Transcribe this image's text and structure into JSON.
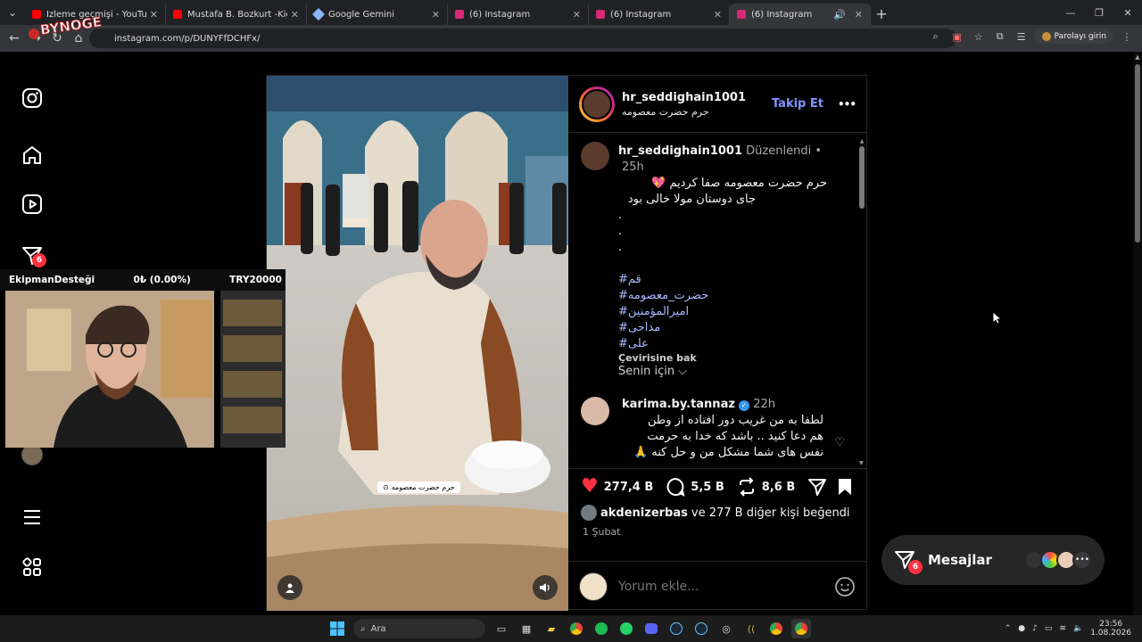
{
  "browser": {
    "tabs": [
      {
        "title": "İzleme geçmişi - YouTube",
        "favicon_color": "#ff0000",
        "active": false
      },
      {
        "title": "Mustafa B. Bozkurt -Kick Kesitle",
        "favicon_color": "#ff0000",
        "active": false
      },
      {
        "title": "Google Gemini",
        "favicon_color": "#8ab4f8",
        "active": false
      },
      {
        "title": "(6) Instagram",
        "favicon_color": "#d62976",
        "active": false
      },
      {
        "title": "(6) Instagram",
        "favicon_color": "#d62976",
        "active": false
      },
      {
        "title": "(6) Instagram",
        "favicon_color": "#d62976",
        "active": true
      }
    ],
    "url": "instagram.com/p/DUNYFfDCHFx/",
    "password_button": "Parolayı girin",
    "overlay_logo_text": "BYNOGE"
  },
  "nav": {
    "notifications_badge": "6"
  },
  "post": {
    "author": "hr_seddighain1001",
    "location": "حرم حضرت معصومه",
    "follow_label": "Takip Et",
    "more_label": "•••",
    "caption": {
      "author": "hr_seddighain1001",
      "edited": "Düzenlendi",
      "dot": "•",
      "time": "25h",
      "line1": "حرم حضرت معصومه صفا کردیم 💖",
      "line2": "جای دوستان مولا خالی بود",
      "dots": [
        ".",
        ".",
        "."
      ],
      "hashtags": [
        "#قم",
        "#حضرت_معصومه",
        "#امیرالمؤمنین",
        "#مداحی",
        "#علی"
      ],
      "translate": "Çevirisine bak"
    },
    "sort_label": "Senin için",
    "comment": {
      "author": "karima.by.tannaz",
      "time": "22h",
      "line1": "لطفا به من غریب دور افتاده از وطن",
      "line2": "هم دعا کنید .. باشد که خدا به حرمت",
      "line3": "نفس های شما مشکل من و حل کنه 🙏"
    },
    "stats": {
      "likes": "277,4 B",
      "comments": "5,5 B",
      "reposts": "8,6 B"
    },
    "liked_by_user": "akdenizerbas",
    "liked_by_rest": "ve 277 B diğer kişi beğendi",
    "date": "1 Şubat",
    "add_comment_placeholder": "Yorum ekle...",
    "media_location_tag": "حرم حضرت معصومه"
  },
  "messages": {
    "label": "Mesajlar",
    "badge": "6"
  },
  "webcam": {
    "left": "EkipmanDesteği",
    "mid": "0₺ (0.00%)",
    "right": "TRY20000"
  },
  "taskbar": {
    "search": "Ara",
    "time": "23:56",
    "date": "1.08.2026"
  },
  "colors": {
    "accent_blue": "#6f8eff",
    "like_red": "#ff3040",
    "bg": "#000000"
  }
}
